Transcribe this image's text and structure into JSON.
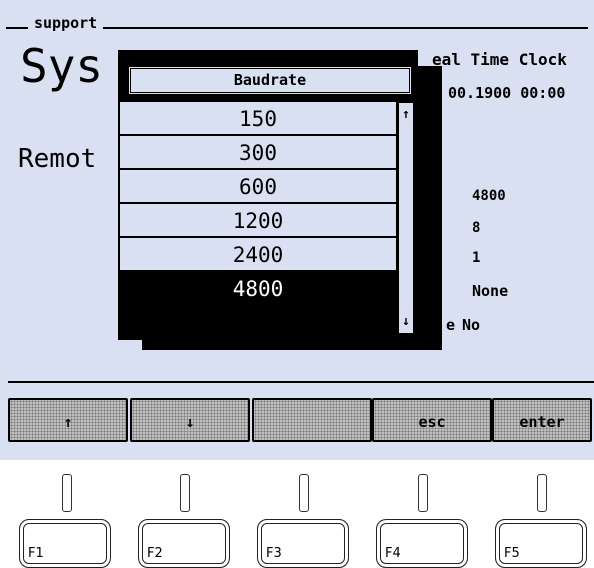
{
  "frame": {
    "title": "support"
  },
  "main": {
    "title_partial": "Sys",
    "section_partial": "Remot",
    "rtc_label_partial": "eal Time Clock",
    "rtc_value": "00.1900 00:00",
    "params": [
      "4800",
      "8",
      "1",
      "None"
    ],
    "last_param_prefix": "e",
    "last_param_value": "No"
  },
  "popup": {
    "header": "Baudrate",
    "items": [
      "150",
      "300",
      "600",
      "1200",
      "2400",
      "4800"
    ],
    "selected_index": 5,
    "scroll_up_icon": "↑",
    "scroll_down_icon": "↓"
  },
  "softkeys": [
    {
      "label": "↑",
      "icon": "arrow-up-icon"
    },
    {
      "label": "↓",
      "icon": "arrow-down-icon"
    },
    {
      "label": ""
    },
    {
      "label": "esc"
    },
    {
      "label": "enter"
    }
  ],
  "function_keys": [
    "F1",
    "F2",
    "F3",
    "F4",
    "F5"
  ]
}
